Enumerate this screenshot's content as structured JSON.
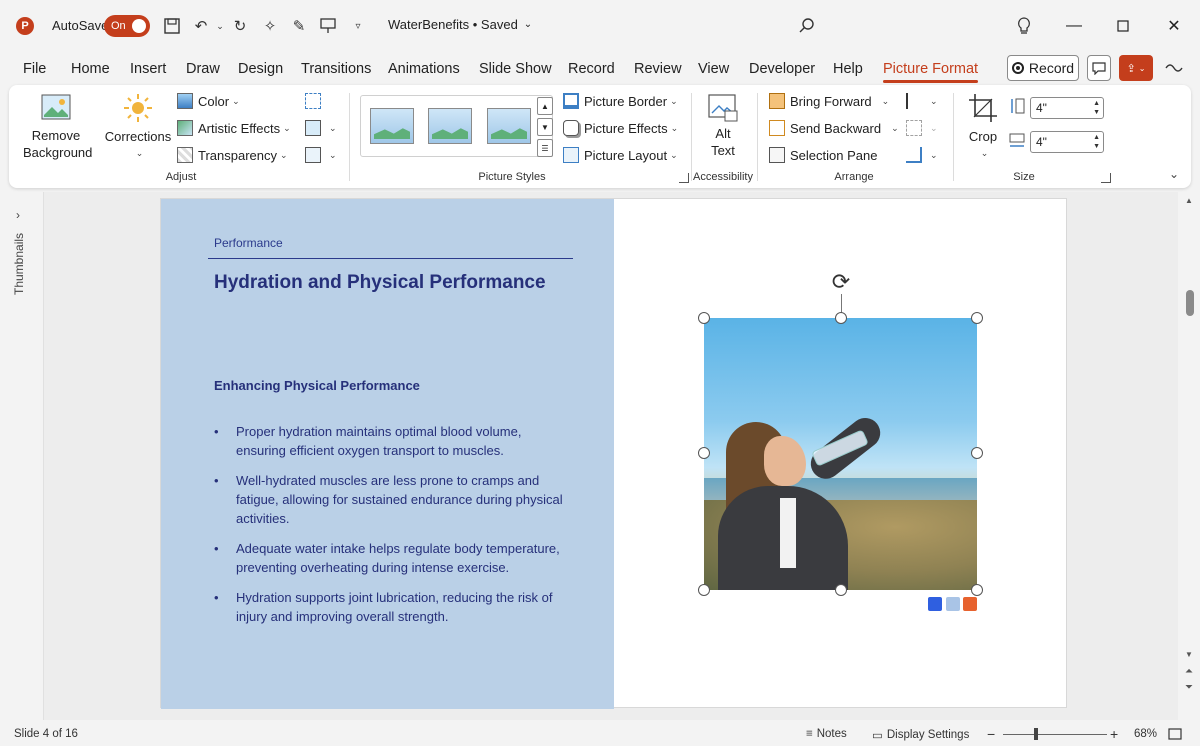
{
  "titlebar": {
    "autosave_label": "AutoSave",
    "autosave_state": "On",
    "doc_title": "WaterBenefits • Saved"
  },
  "menu": {
    "tabs": [
      "File",
      "Home",
      "Insert",
      "Draw",
      "Design",
      "Transitions",
      "Animations",
      "Slide Show",
      "Record",
      "Review",
      "View",
      "Developer",
      "Help",
      "Picture Format"
    ],
    "active_tab": "Picture Format",
    "record_label": "Record"
  },
  "ribbon": {
    "remove_background": "Remove Background",
    "corrections": "Corrections",
    "color": "Color",
    "artistic_effects": "Artistic Effects",
    "transparency": "Transparency",
    "adjust_label": "Adjust",
    "picture_border": "Picture Border",
    "picture_effects": "Picture Effects",
    "picture_layout": "Picture Layout",
    "picture_styles_label": "Picture Styles",
    "alt_text": "Alt Text",
    "accessibility_label": "Accessibility",
    "bring_forward": "Bring Forward",
    "send_backward": "Send Backward",
    "selection_pane": "Selection Pane",
    "arrange_label": "Arrange",
    "crop": "Crop",
    "height_value": "4\"",
    "width_value": "4\"",
    "size_label": "Size"
  },
  "thumbnails_label": "Thumbnails",
  "slide": {
    "section_label": "Performance",
    "title": "Hydration and Physical Performance",
    "subtitle": "Enhancing Physical Performance",
    "bullets": [
      "Proper hydration maintains optimal blood volume, ensuring efficient oxygen transport to muscles.",
      "Well-hydrated muscles are less prone to cramps and fatigue, allowing for sustained endurance during physical activities.",
      "Adequate water intake helps regulate body temperature, preventing overheating during intense exercise.",
      "Hydration supports joint lubrication, reducing the risk of injury and improving overall strength."
    ]
  },
  "status": {
    "slide_info": "Slide 4 of 16",
    "notes": "Notes",
    "display_settings": "Display Settings",
    "zoom": "68%"
  },
  "colors": {
    "accent": "#c43e1c",
    "slide_panel": "#bad0e7",
    "text_navy": "#26307a",
    "swatch_1": "#2f5fe0",
    "swatch_2": "#a9c4e6",
    "swatch_3": "#e7622e"
  }
}
